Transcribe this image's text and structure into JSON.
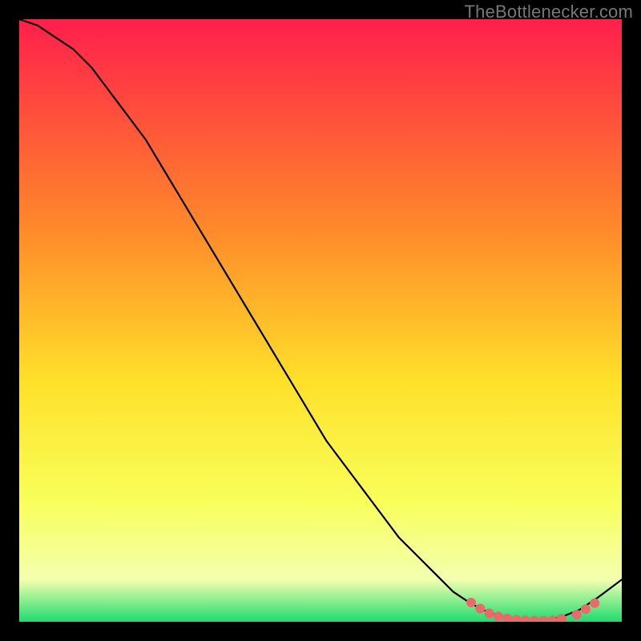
{
  "attribution": "TheBottlenecker.com",
  "colors": {
    "background": "#000000",
    "gradient_top": "#ff1f4b",
    "gradient_upper_mid": "#ff8a2a",
    "gradient_mid": "#ffe02a",
    "gradient_lower_mid": "#f8ff5a",
    "gradient_low": "#f4ffb0",
    "gradient_bottom": "#1edc6f",
    "curve": "#000000",
    "markers": "#e86a6a"
  },
  "chart_data": {
    "type": "line",
    "title": "",
    "xlabel": "",
    "ylabel": "",
    "xlim": [
      0,
      100
    ],
    "ylim": [
      0,
      100
    ],
    "series": [
      {
        "name": "curve",
        "x": [
          0,
          3,
          6,
          9,
          12,
          15,
          18,
          21,
          24,
          27,
          30,
          33,
          36,
          39,
          42,
          45,
          48,
          51,
          54,
          57,
          60,
          63,
          66,
          69,
          72,
          75,
          78,
          81,
          84,
          87,
          90,
          93,
          96,
          100
        ],
        "y": [
          100,
          99,
          97,
          95,
          92,
          88,
          84,
          80,
          75,
          70,
          65,
          60,
          55,
          50,
          45,
          40,
          35,
          30,
          26,
          22,
          18,
          14,
          11,
          8,
          5,
          3,
          1.5,
          0.6,
          0.2,
          0.2,
          0.8,
          2,
          4,
          7
        ]
      }
    ],
    "markers": [
      {
        "x": 75,
        "y": 3.2
      },
      {
        "x": 76.5,
        "y": 2.2
      },
      {
        "x": 78,
        "y": 1.4
      },
      {
        "x": 79.5,
        "y": 0.9
      },
      {
        "x": 81,
        "y": 0.55
      },
      {
        "x": 82.5,
        "y": 0.35
      },
      {
        "x": 84,
        "y": 0.25
      },
      {
        "x": 85.5,
        "y": 0.2
      },
      {
        "x": 87,
        "y": 0.2
      },
      {
        "x": 88.5,
        "y": 0.25
      },
      {
        "x": 90,
        "y": 0.5
      },
      {
        "x": 92.5,
        "y": 1.2
      },
      {
        "x": 94,
        "y": 2.1
      },
      {
        "x": 95.5,
        "y": 3.1
      }
    ]
  }
}
